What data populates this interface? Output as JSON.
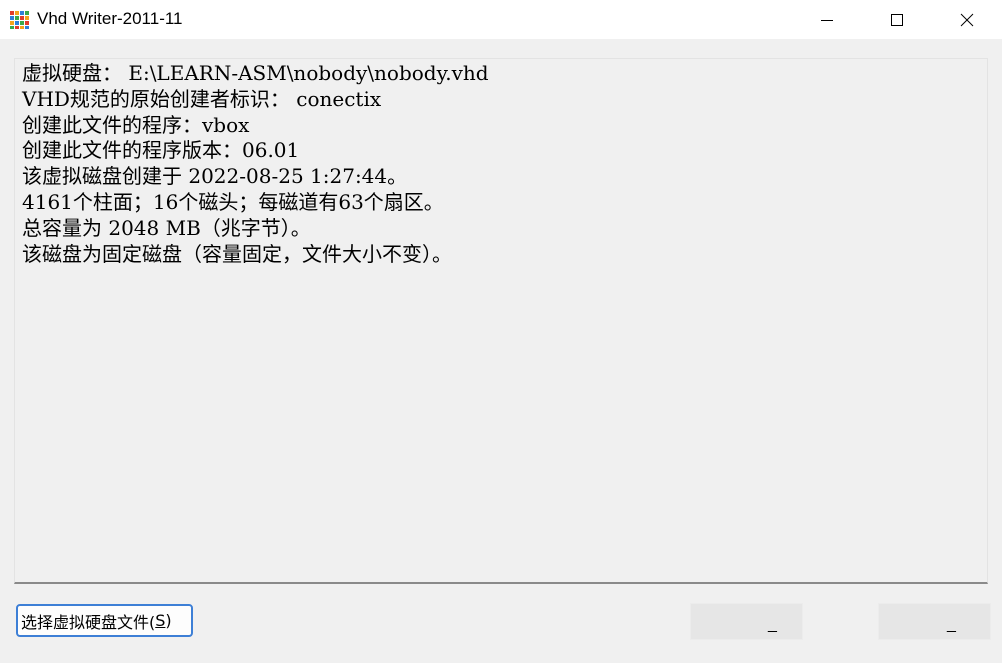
{
  "window": {
    "title": "Vhd Writer-2011-11",
    "app_icon": "grid-app-icon",
    "controls": {
      "minimize_icon": "minimize-icon",
      "maximize_icon": "maximize-icon",
      "close_icon": "close-icon"
    }
  },
  "info": {
    "lines": [
      "虚拟硬盘： E:\\LEARN-ASM\\nobody\\nobody.vhd",
      "VHD规范的原始创建者标识： conectix",
      "创建此文件的程序：vbox",
      "创建此文件的程序版本：06.01",
      "该虚拟磁盘创建于 2022-08-25 1:27:44。",
      "4161个柱面；16个磁头；每磁道有63个扇区。",
      "总容量为 2048 MB（兆字节）。",
      "该磁盘为固定磁盘（容量固定，文件大小不变）。"
    ]
  },
  "buttons": {
    "select_label": "选择虚拟硬盘文件(",
    "select_accel": "S",
    "select_suffix": ")",
    "button_a_label": "_",
    "button_b_label": "_"
  },
  "colors": {
    "focus_border": "#3d7fd6",
    "background": "#f0f0f0"
  }
}
